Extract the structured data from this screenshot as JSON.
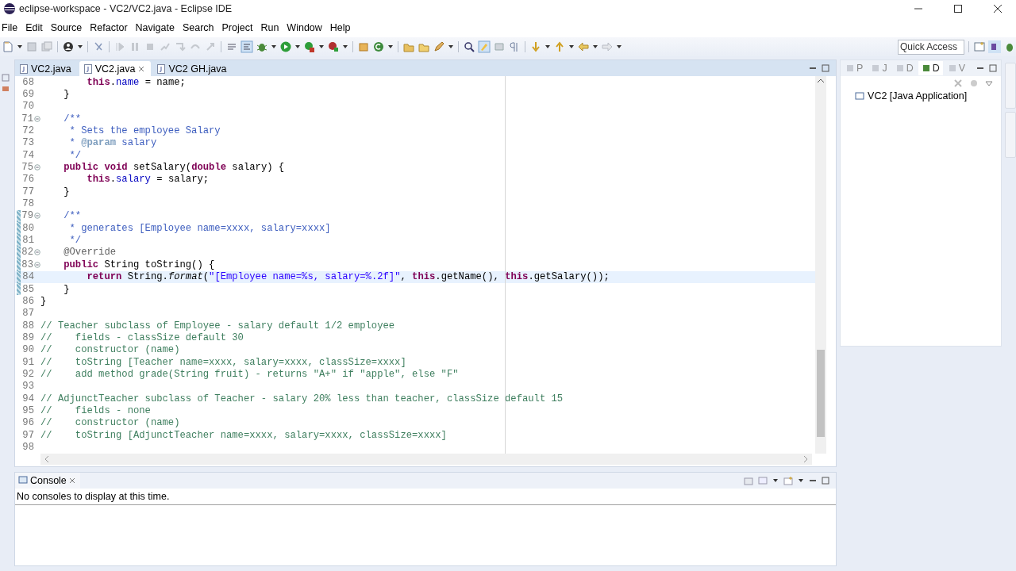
{
  "window": {
    "title": "eclipse-workspace - VC2/VC2.java - Eclipse IDE"
  },
  "menu": [
    "File",
    "Edit",
    "Source",
    "Refactor",
    "Navigate",
    "Search",
    "Project",
    "Run",
    "Window",
    "Help"
  ],
  "quick_access": {
    "placeholder": "Quick Access"
  },
  "editor_tabs": [
    {
      "label": "VC2.java",
      "selected": false
    },
    {
      "label": "VC2.java",
      "selected": true
    },
    {
      "label": "VC2 GH.java",
      "selected": false
    }
  ],
  "code_lines": [
    {
      "number": "68",
      "folding": false,
      "changed": false,
      "current": false,
      "tokens": [
        {
          "kind": "keyword",
          "text": "        this"
        },
        {
          "kind": "plain",
          "text": "."
        },
        {
          "kind": "field",
          "text": "name"
        },
        {
          "kind": "plain",
          "text": " = name;"
        }
      ]
    },
    {
      "number": "69",
      "folding": false,
      "changed": false,
      "current": false,
      "tokens": [
        {
          "kind": "plain",
          "text": "    }"
        }
      ]
    },
    {
      "number": "70",
      "folding": false,
      "changed": false,
      "current": false
    },
    {
      "number": "71",
      "folding": true,
      "changed": false,
      "current": false,
      "tokens": [
        {
          "kind": "javadoc",
          "text": "    /**"
        }
      ]
    },
    {
      "number": "72",
      "folding": false,
      "changed": false,
      "current": false,
      "tokens": [
        {
          "kind": "javadoc",
          "text": "     * Sets the employee Salary"
        }
      ]
    },
    {
      "number": "73",
      "folding": false,
      "changed": false,
      "current": false,
      "tokens": [
        {
          "kind": "javadoc",
          "text": "     * "
        },
        {
          "kind": "tag",
          "text": "@param"
        },
        {
          "kind": "javadoc",
          "text": " salary"
        }
      ]
    },
    {
      "number": "74",
      "folding": false,
      "changed": false,
      "current": false,
      "tokens": [
        {
          "kind": "javadoc",
          "text": "     */"
        }
      ]
    },
    {
      "number": "75",
      "folding": true,
      "changed": false,
      "current": false,
      "tokens": [
        {
          "kind": "keyword",
          "text": "    public"
        },
        {
          "kind": "keyword",
          "text": " void"
        },
        {
          "kind": "plain",
          "text": " setSalary("
        },
        {
          "kind": "keyword",
          "text": "double"
        },
        {
          "kind": "plain",
          "text": " salary) {"
        }
      ]
    },
    {
      "number": "76",
      "folding": false,
      "changed": false,
      "current": false,
      "tokens": [
        {
          "kind": "keyword",
          "text": "        this"
        },
        {
          "kind": "plain",
          "text": "."
        },
        {
          "kind": "field",
          "text": "salary"
        },
        {
          "kind": "plain",
          "text": " = salary;"
        }
      ]
    },
    {
      "number": "77",
      "folding": false,
      "changed": false,
      "current": false,
      "tokens": [
        {
          "kind": "plain",
          "text": "    }"
        }
      ]
    },
    {
      "number": "78",
      "folding": false,
      "changed": false,
      "current": false
    },
    {
      "number": "79",
      "folding": true,
      "changed": true,
      "current": false,
      "tokens": [
        {
          "kind": "javadoc",
          "text": "    /**"
        }
      ]
    },
    {
      "number": "80",
      "folding": false,
      "changed": true,
      "current": false,
      "tokens": [
        {
          "kind": "javadoc",
          "text": "     * generates [Employee name=xxxx, salary=xxxx]"
        }
      ]
    },
    {
      "number": "81",
      "folding": false,
      "changed": true,
      "current": false,
      "tokens": [
        {
          "kind": "javadoc",
          "text": "     */"
        }
      ]
    },
    {
      "number": "82",
      "folding": true,
      "changed": true,
      "current": false,
      "tokens": [
        {
          "kind": "annotation",
          "text": "    @Override"
        }
      ]
    },
    {
      "number": "83",
      "folding": true,
      "changed": true,
      "current": false,
      "tokens": [
        {
          "kind": "keyword",
          "text": "    public"
        },
        {
          "kind": "plain",
          "text": " String toString() {"
        }
      ]
    },
    {
      "number": "84",
      "folding": false,
      "changed": true,
      "current": true,
      "tokens": [
        {
          "kind": "keyword",
          "text": "        return"
        },
        {
          "kind": "plain",
          "text": " String."
        },
        {
          "kind": "method",
          "text": "format"
        },
        {
          "kind": "plain",
          "text": "("
        },
        {
          "kind": "string",
          "text": "\"[Employee name=%s, salary=%.2f]\""
        },
        {
          "kind": "plain",
          "text": ", "
        },
        {
          "kind": "keyword",
          "text": "this"
        },
        {
          "kind": "plain",
          "text": ".getName(), "
        },
        {
          "kind": "keyword",
          "text": "this"
        },
        {
          "kind": "plain",
          "text": ".getSalary());"
        }
      ]
    },
    {
      "number": "85",
      "folding": false,
      "changed": true,
      "current": false,
      "tokens": [
        {
          "kind": "plain",
          "text": "    }"
        }
      ]
    },
    {
      "number": "86",
      "folding": false,
      "changed": false,
      "current": false,
      "tokens": [
        {
          "kind": "plain",
          "text": "}"
        }
      ]
    },
    {
      "number": "87",
      "folding": false,
      "changed": false,
      "current": false
    },
    {
      "number": "88",
      "folding": false,
      "changed": false,
      "current": false,
      "tokens": [
        {
          "kind": "comment",
          "text": "// Teacher subclass of Employee - salary default 1/2 employee"
        }
      ]
    },
    {
      "number": "89",
      "folding": false,
      "changed": false,
      "current": false,
      "tokens": [
        {
          "kind": "comment",
          "text": "//    fields - classSize default 30"
        }
      ]
    },
    {
      "number": "90",
      "folding": false,
      "changed": false,
      "current": false,
      "tokens": [
        {
          "kind": "comment",
          "text": "//    constructor (name)"
        }
      ]
    },
    {
      "number": "91",
      "folding": false,
      "changed": false,
      "current": false,
      "tokens": [
        {
          "kind": "comment",
          "text": "//    toString [Teacher name=xxxx, salary=xxxx, classSize=xxxx]"
        }
      ]
    },
    {
      "number": "92",
      "folding": false,
      "changed": false,
      "current": false,
      "tokens": [
        {
          "kind": "comment",
          "text": "//    add method grade(String fruit) - returns \"A+\" if \"apple\", else \"F\""
        }
      ]
    },
    {
      "number": "93",
      "folding": false,
      "changed": false,
      "current": false
    },
    {
      "number": "94",
      "folding": false,
      "changed": false,
      "current": false,
      "tokens": [
        {
          "kind": "comment",
          "text": "// AdjunctTeacher subclass of Teacher - salary 20% less than teacher, classSize default 15"
        }
      ]
    },
    {
      "number": "95",
      "folding": false,
      "changed": false,
      "current": false,
      "tokens": [
        {
          "kind": "comment",
          "text": "//    fields - none"
        }
      ]
    },
    {
      "number": "96",
      "folding": false,
      "changed": false,
      "current": false,
      "tokens": [
        {
          "kind": "comment",
          "text": "//    constructor (name)"
        }
      ]
    },
    {
      "number": "97",
      "folding": false,
      "changed": false,
      "current": false,
      "tokens": [
        {
          "kind": "comment",
          "text": "//    toString [AdjunctTeacher name=xxxx, salary=xxxx, classSize=xxxx]"
        }
      ]
    },
    {
      "number": "98",
      "folding": false,
      "changed": false,
      "current": false
    }
  ],
  "side_view": {
    "tabs": [
      {
        "label": "P",
        "selected": false
      },
      {
        "label": "J",
        "selected": false
      },
      {
        "label": "D",
        "selected": false
      },
      {
        "label": "D",
        "selected": true
      },
      {
        "label": "V",
        "selected": false
      }
    ],
    "items": [
      "VC2 [Java Application]"
    ]
  },
  "console": {
    "tab": "Console",
    "message": "No consoles to display at this time."
  }
}
